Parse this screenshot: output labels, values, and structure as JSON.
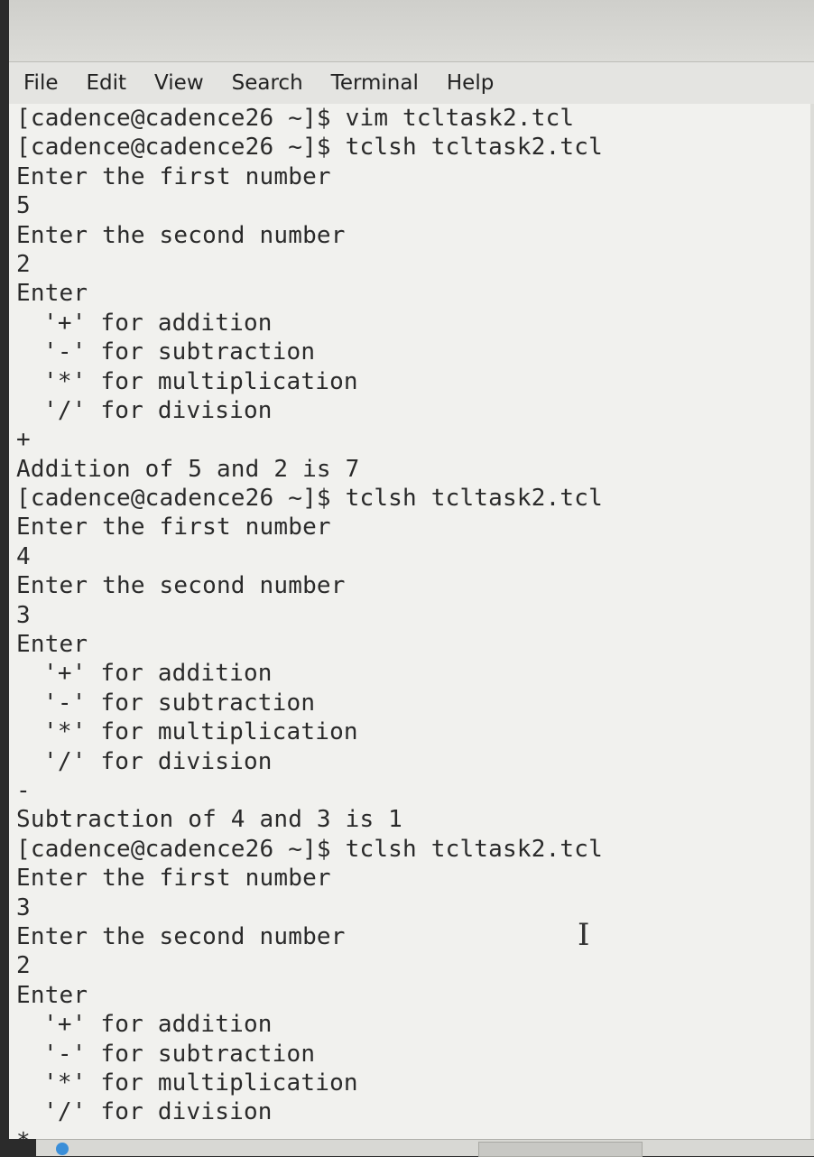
{
  "menu": [
    "File",
    "Edit",
    "View",
    "Search",
    "Terminal",
    "Help"
  ],
  "lines": [
    {
      "text": "[cadence@cadence26 ~]$ vim tcltask2.tcl",
      "indent": false
    },
    {
      "text": "[cadence@cadence26 ~]$ tclsh tcltask2.tcl",
      "indent": false
    },
    {
      "text": "Enter the first number",
      "indent": false
    },
    {
      "text": "5",
      "indent": false
    },
    {
      "text": "Enter the second number",
      "indent": false
    },
    {
      "text": "2",
      "indent": false
    },
    {
      "text": "Enter",
      "indent": false
    },
    {
      "text": "'+' for addition",
      "indent": true
    },
    {
      "text": "'-' for subtraction",
      "indent": true
    },
    {
      "text": "'*' for multiplication",
      "indent": true
    },
    {
      "text": "'/' for division",
      "indent": true
    },
    {
      "text": "+",
      "indent": false
    },
    {
      "text": "Addition of 5 and 2 is 7",
      "indent": false
    },
    {
      "text": "[cadence@cadence26 ~]$ tclsh tcltask2.tcl",
      "indent": false
    },
    {
      "text": "Enter the first number",
      "indent": false
    },
    {
      "text": "4",
      "indent": false
    },
    {
      "text": "Enter the second number",
      "indent": false
    },
    {
      "text": "3",
      "indent": false
    },
    {
      "text": "Enter",
      "indent": false
    },
    {
      "text": "'+' for addition",
      "indent": true
    },
    {
      "text": "'-' for subtraction",
      "indent": true
    },
    {
      "text": "'*' for multiplication",
      "indent": true
    },
    {
      "text": "'/' for division",
      "indent": true
    },
    {
      "text": "-",
      "indent": false
    },
    {
      "text": "Subtraction of 4 and 3 is 1",
      "indent": false
    },
    {
      "text": "[cadence@cadence26 ~]$ tclsh tcltask2.tcl",
      "indent": false
    },
    {
      "text": "Enter the first number",
      "indent": false
    },
    {
      "text": "3",
      "indent": false
    },
    {
      "text": "Enter the second number",
      "indent": false
    },
    {
      "text": "2",
      "indent": false
    },
    {
      "text": "Enter",
      "indent": false
    },
    {
      "text": "'+' for addition",
      "indent": true
    },
    {
      "text": "'-' for subtraction",
      "indent": true
    },
    {
      "text": "'*' for multiplication",
      "indent": true
    },
    {
      "text": "'/' for division",
      "indent": true
    },
    {
      "text": "*",
      "indent": false
    }
  ],
  "icons": {
    "mouse_cursor": "text-cursor-icon",
    "ibeam_glyph": "I"
  }
}
